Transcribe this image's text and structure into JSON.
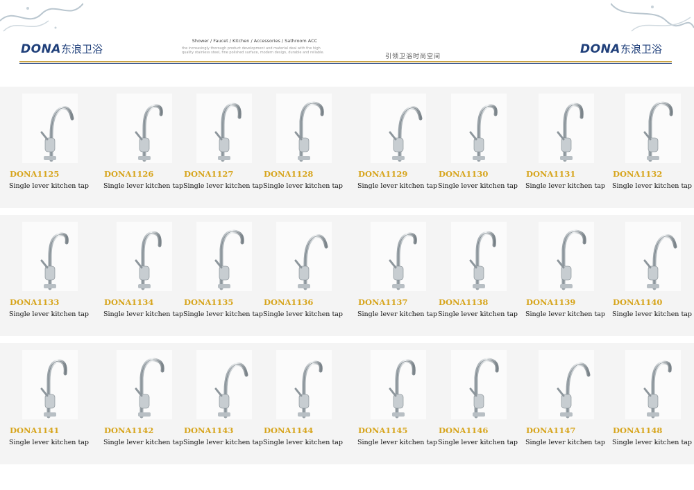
{
  "header": {
    "brand": "DONA",
    "brand_cn": "东浪卫浴",
    "tagline": "Shower / Faucet / Kitchen / Accessories / Sathroom ACC",
    "tagline_small": "the increasingly thorough product development and material deal with the high quality stainless steel, fine polished surface, modern design, durable and reliable.",
    "slogan": "引领卫浴时尚空间"
  },
  "colors": {
    "code": "#d7a51d",
    "brand": "#1f3f7a",
    "rule_gold": "#c9a447",
    "rule_blue": "#2a4a86"
  },
  "rows": [
    {
      "items": [
        {
          "code": "DONA1125",
          "desc": "Single lever kitchen tap"
        },
        {
          "code": "DONA1126",
          "desc": "Single lever kitchen tap"
        },
        {
          "code": "DONA1127",
          "desc": "Single lever kitchen tap"
        },
        {
          "code": "DONA1128",
          "desc": "Single lever kitchen tap"
        },
        {
          "code": "DONA1129",
          "desc": "Single lever kitchen tap"
        },
        {
          "code": "DONA1130",
          "desc": "Single lever kitchen tap"
        },
        {
          "code": "DONA1131",
          "desc": "Single lever kitchen tap"
        },
        {
          "code": "DONA1132",
          "desc": "Single lever kitchen tap"
        }
      ]
    },
    {
      "items": [
        {
          "code": "DONA1133",
          "desc": "Single lever kitchen tap"
        },
        {
          "code": "DONA1134",
          "desc": "Single lever kitchen tap"
        },
        {
          "code": "DONA1135",
          "desc": "Single lever kitchen tap"
        },
        {
          "code": "DONA1136",
          "desc": "Single lever kitchen tap"
        },
        {
          "code": "DONA1137",
          "desc": "Single lever kitchen tap"
        },
        {
          "code": "DONA1138",
          "desc": "Single lever kitchen tap"
        },
        {
          "code": "DONA1139",
          "desc": "Single lever kitchen tap"
        },
        {
          "code": "DONA1140",
          "desc": "Single lever kitchen tap"
        }
      ]
    },
    {
      "items": [
        {
          "code": "DONA1141",
          "desc": "Single lever kitchen tap"
        },
        {
          "code": "DONA1142",
          "desc": "Single lever kitchen tap"
        },
        {
          "code": "DONA1143",
          "desc": "Single lever kitchen tap"
        },
        {
          "code": "DONA1144",
          "desc": "Single lever kitchen tap"
        },
        {
          "code": "DONA1145",
          "desc": "Single lever kitchen tap"
        },
        {
          "code": "DONA1146",
          "desc": "Single lever kitchen tap"
        },
        {
          "code": "DONA1147",
          "desc": "Single lever kitchen tap"
        },
        {
          "code": "DONA1148",
          "desc": "Single lever kitchen tap"
        }
      ]
    }
  ]
}
